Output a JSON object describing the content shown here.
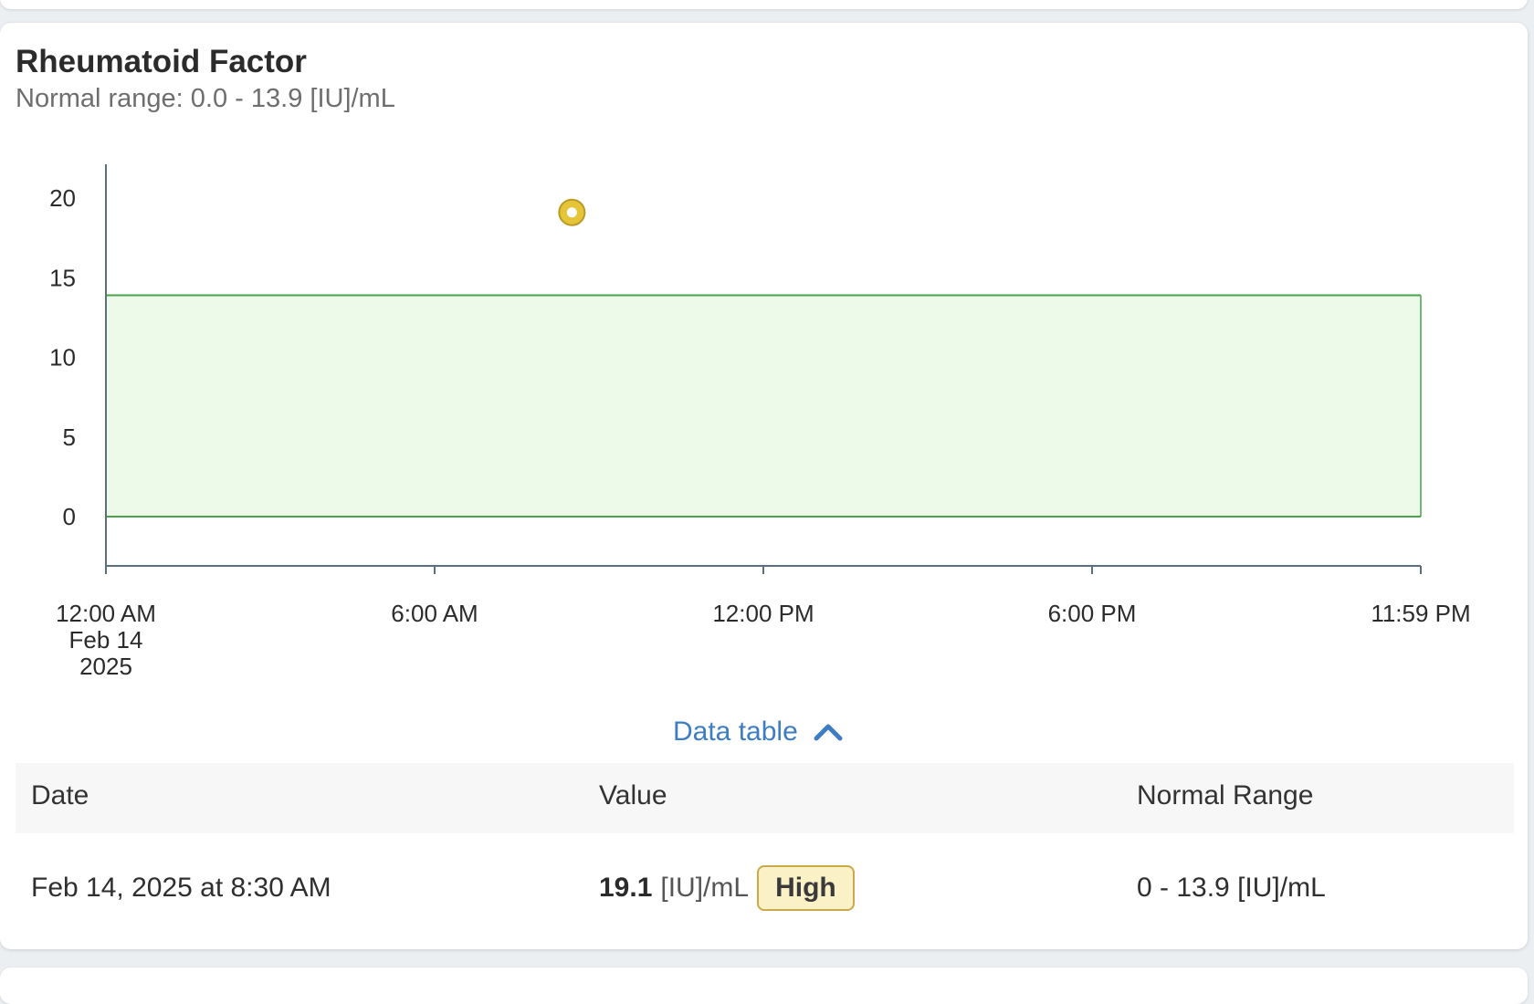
{
  "card": {
    "title": "Rheumatoid Factor",
    "normal_range_text": "Normal range: 0.0 - 13.9 [IU]/mL"
  },
  "colors": {
    "normal_band_fill": "#edf9e9",
    "normal_band_stroke": "#4aa34a",
    "point_fill": "#e6c437",
    "point_stroke": "#b89a24",
    "link": "#3e7cc4",
    "badge_fill": "#fbf1c7",
    "badge_border": "#c9a94a"
  },
  "chart_data": {
    "type": "scatter",
    "y_ticks": [
      "20",
      "15",
      "10",
      "5",
      "0"
    ],
    "x_ticks": [
      {
        "line1": "12:00 AM",
        "line2": "Feb 14",
        "line3": "2025"
      },
      {
        "line1": "6:00 AM"
      },
      {
        "line1": "12:00 PM"
      },
      {
        "line1": "6:00 PM"
      },
      {
        "line1": "11:59 PM"
      }
    ],
    "xlim_hours": [
      0,
      23.983
    ],
    "ylim": [
      -3,
      23
    ],
    "normal_range": [
      0,
      13.9
    ],
    "points": [
      {
        "x_hour": 8.5,
        "y": 19.1,
        "status": "high"
      }
    ],
    "grid": false
  },
  "table_toggle": {
    "label": "Data table",
    "icon": "chevron-up-icon"
  },
  "table": {
    "headers": [
      "Date",
      "Value",
      "Normal Range"
    ],
    "rows": [
      {
        "date": "Feb 14, 2025 at 8:30 AM",
        "value": "19.1",
        "unit": "[IU]/mL",
        "flag": "High",
        "range": "0 - 13.9 [IU]/mL"
      }
    ]
  }
}
